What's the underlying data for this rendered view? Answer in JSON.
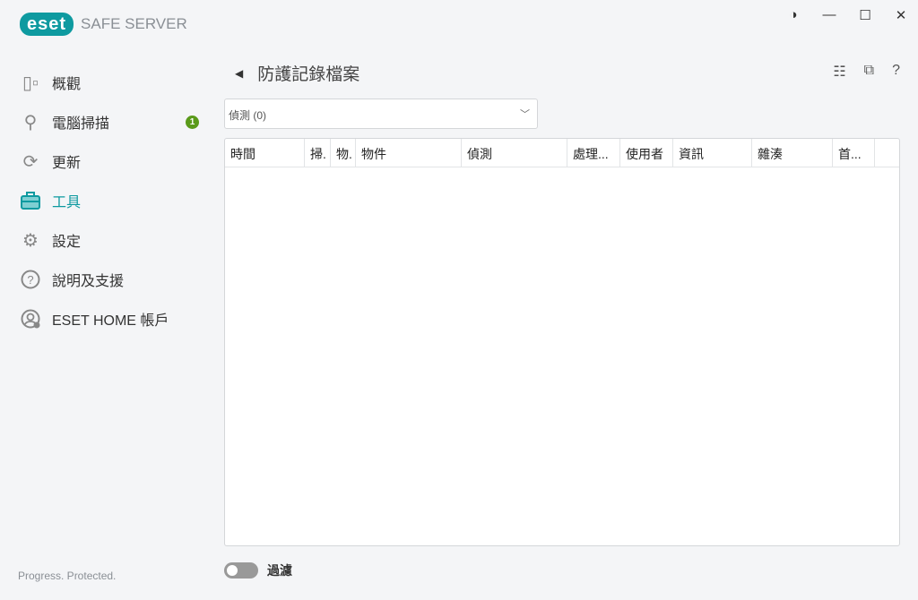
{
  "app": {
    "logo": "eset",
    "product": "SAFE SERVER",
    "tagline": "Progress. Protected."
  },
  "window": {
    "theme": "◑",
    "minimize": "—",
    "maximize": "☐",
    "close": "✕"
  },
  "sidebar": {
    "items": [
      {
        "label": "概觀",
        "icon": "overview-icon"
      },
      {
        "label": "電腦掃描",
        "icon": "search-icon",
        "badge": "1"
      },
      {
        "label": "更新",
        "icon": "refresh-icon"
      },
      {
        "label": "工具",
        "icon": "toolbox-icon",
        "active": true
      },
      {
        "label": "設定",
        "icon": "gear-icon"
      },
      {
        "label": "說明及支援",
        "icon": "help-icon"
      },
      {
        "label": "ESET HOME 帳戶",
        "icon": "account-icon"
      }
    ]
  },
  "main": {
    "back": "◀",
    "title": "防護記錄檔案",
    "tools": {
      "view": "☷",
      "copy": "⧉",
      "help": "?"
    },
    "log_select": {
      "value": "偵測 (0)"
    },
    "table": {
      "columns": [
        "時間",
        "掃.",
        "物.",
        "物件",
        "偵測",
        "處理...",
        "使用者",
        "資訊",
        "雜湊",
        "首...",
        ""
      ],
      "rows": []
    },
    "filter": {
      "label": "過濾",
      "enabled": false
    }
  },
  "colors": {
    "accent": "#0e9aa0",
    "badge": "#5a9a1a"
  }
}
